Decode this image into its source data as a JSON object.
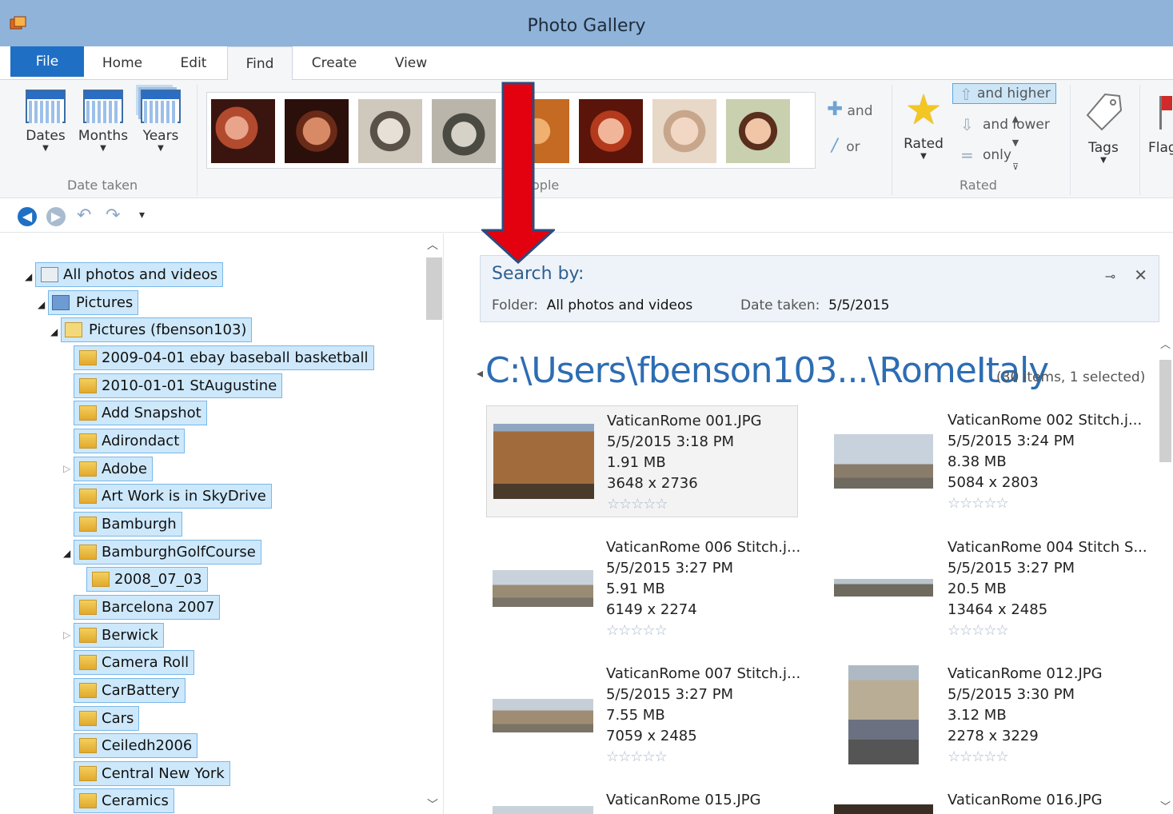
{
  "window": {
    "title": "Photo Gallery"
  },
  "tabs": [
    "File",
    "Home",
    "Edit",
    "Find",
    "Create",
    "View"
  ],
  "ribbon": {
    "date_taken": {
      "buttons": [
        "Dates",
        "Months",
        "Years"
      ],
      "label": "Date taken"
    },
    "people": {
      "label": "ople",
      "and_label": "and",
      "or_label": "or"
    },
    "rated": {
      "button": "Rated",
      "and_higher": "and higher",
      "and_lower": "and lower",
      "only": "only",
      "label": "Rated"
    },
    "tags": "Tags",
    "flag": "Flag"
  },
  "tree": {
    "items": [
      "All photos and videos",
      "Pictures",
      "Pictures (fbenson103)",
      "2009-04-01 ebay baseball basketball",
      "2010-01-01 StAugustine",
      "Add Snapshot",
      "Adirondact",
      "Adobe",
      "Art Work is in SkyDrive",
      "Bamburgh",
      "BamburghGolfCourse",
      "2008_07_03",
      "Barcelona 2007",
      "Berwick",
      "Camera Roll",
      "CarBattery",
      "Cars",
      "Ceiledh2006",
      "Central New York",
      "Ceramics"
    ]
  },
  "search": {
    "title": "Search by:",
    "folder_label": "Folder:",
    "folder_value": "All photos and videos",
    "date_label": "Date taken:",
    "date_value": "5/5/2015"
  },
  "content": {
    "path": "C:\\Users\\fbenson103...\\RomeItaly",
    "count": "(30 items, 1 selected)",
    "items": [
      {
        "name": "VaticanRome 001.JPG",
        "date": "5/5/2015 3:18 PM",
        "size": "1.91 MB",
        "dims": "3648 x 2736"
      },
      {
        "name": "VaticanRome 002 Stitch.j...",
        "date": "5/5/2015 3:24 PM",
        "size": "8.38 MB",
        "dims": "5084 x 2803"
      },
      {
        "name": "VaticanRome 006 Stitch.j...",
        "date": "5/5/2015 3:27 PM",
        "size": "5.91 MB",
        "dims": "6149 x 2274"
      },
      {
        "name": "VaticanRome 004 Stitch S...",
        "date": "5/5/2015 3:27 PM",
        "size": "20.5 MB",
        "dims": "13464 x 2485"
      },
      {
        "name": "VaticanRome 007 Stitch.j...",
        "date": "5/5/2015 3:27 PM",
        "size": "7.55 MB",
        "dims": "7059 x 2485"
      },
      {
        "name": "VaticanRome 012.JPG",
        "date": "5/5/2015 3:30 PM",
        "size": "3.12 MB",
        "dims": "2278 x 3229"
      },
      {
        "name": "VaticanRome 015.JPG"
      },
      {
        "name": "VaticanRome 016.JPG"
      }
    ],
    "stars": "☆☆☆☆☆"
  },
  "colors": {
    "accent": "#1f6fc5",
    "titlebar": "#8fb3d9",
    "annotation_arrow": "#e3000f"
  }
}
